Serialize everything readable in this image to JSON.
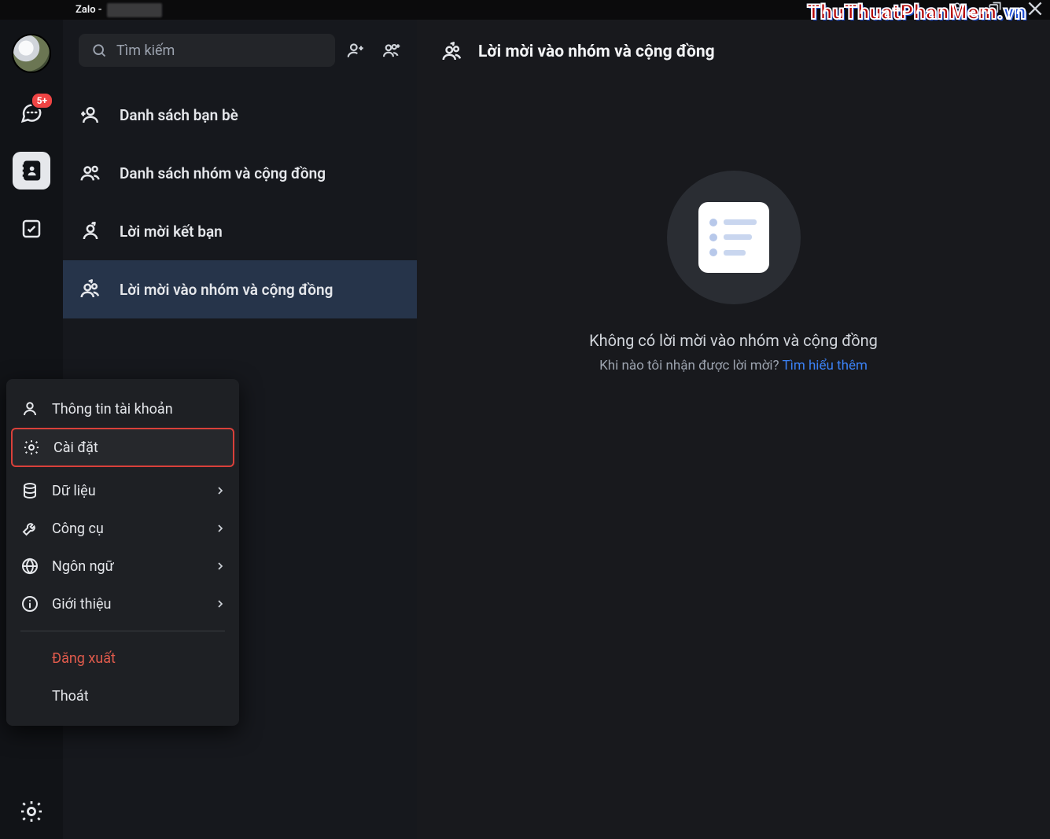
{
  "titlebar": {
    "app_name": "Zalo -"
  },
  "watermark": {
    "part1": "ThuThuatPhanMem",
    "part2": ".vn"
  },
  "rail": {
    "chat_badge": "5+"
  },
  "search": {
    "placeholder": "Tìm kiếm"
  },
  "list": {
    "items": [
      {
        "label": "Danh sách bạn bè"
      },
      {
        "label": "Danh sách nhóm và cộng đồng"
      },
      {
        "label": "Lời mời kết bạn"
      },
      {
        "label": "Lời mời vào nhóm và cộng đồng"
      }
    ]
  },
  "main": {
    "heading": "Lời mời vào nhóm và cộng đồng",
    "empty_title": "Không có lời mời vào nhóm và cộng đồng",
    "empty_sub_prefix": "Khi nào tôi nhận được lời mời? ",
    "empty_link": "Tìm hiểu thêm"
  },
  "menu": {
    "account": "Thông tin tài khoản",
    "settings": "Cài đặt",
    "data": "Dữ liệu",
    "tools": "Công cụ",
    "language": "Ngôn ngữ",
    "about": "Giới thiệu",
    "logout": "Đăng xuất",
    "exit": "Thoát"
  }
}
